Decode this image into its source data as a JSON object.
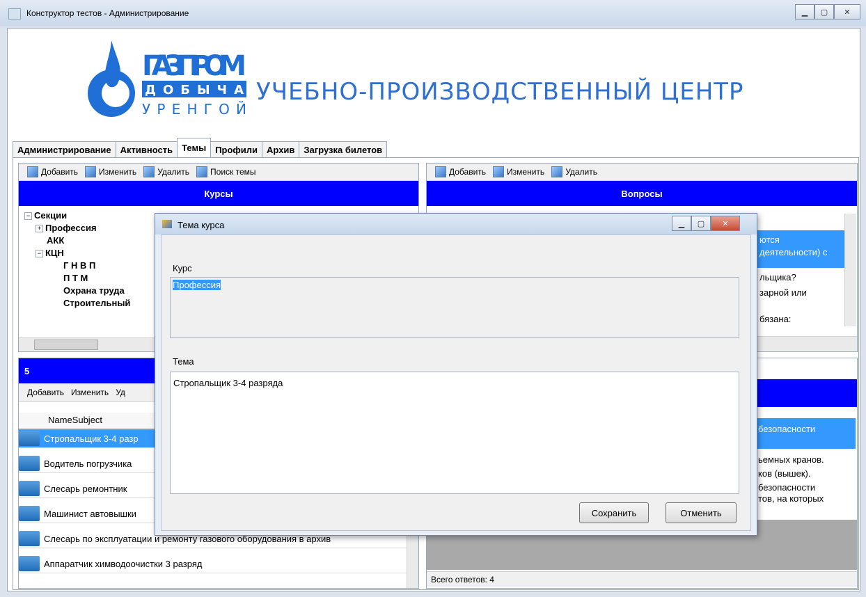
{
  "window": {
    "title": "Конструктор тестов - Администрирование",
    "caption_buttons": [
      "minimize",
      "maximize",
      "close"
    ]
  },
  "header": {
    "logo": {
      "line1": "ГАЗПРОМ",
      "line2": "ДОБЫЧА",
      "line3": "УРЕНГОЙ"
    },
    "title": "УЧЕБНО-ПРОИЗВОДСТВЕННЫЙ ЦЕНТР"
  },
  "tabs": [
    {
      "label": "Администрирование",
      "selected": false
    },
    {
      "label": "Активность",
      "selected": false
    },
    {
      "label": "Темы",
      "selected": true
    },
    {
      "label": "Профили",
      "selected": false
    },
    {
      "label": "Архив",
      "selected": false
    },
    {
      "label": "Загрузка билетов",
      "selected": false
    }
  ],
  "left_toolbar": {
    "add": "Добавить",
    "edit": "Изменить",
    "delete": "Удалить",
    "search": "Поиск темы"
  },
  "courses": {
    "header": "Курсы",
    "tree": [
      {
        "label": "Секции",
        "expander": "-"
      },
      {
        "label": "Профессия",
        "expander": "+"
      },
      {
        "label": "АКК",
        "expander": ""
      },
      {
        "label": "КЦН",
        "expander": "-"
      },
      {
        "label": "Г Н В П",
        "expander": ""
      },
      {
        "label": "П Т М",
        "expander": ""
      },
      {
        "label": "Охрана труда",
        "expander": ""
      },
      {
        "label": "Строительный",
        "expander": ""
      }
    ]
  },
  "subjects": {
    "count_header": "5",
    "toolbar": {
      "add": "Добавить",
      "edit": "Изменить",
      "delete": "Уд"
    },
    "column": "NameSubject",
    "rows": [
      "Стропальщик 3-4 разр",
      "Водитель погрузчика",
      "Слесарь ремонтник",
      "Машинист автовышки",
      "Слесарь по эксплуатации и ремонту газового оборудования в архив",
      "Аппаратчик химводоочистки 3 разряд"
    ]
  },
  "right_toolbar": {
    "add": "Добавить",
    "edit": "Изменить",
    "delete": "Удалить"
  },
  "questions": {
    "header": "Вопросы",
    "visible_fragments": [
      "ются",
      "деятельности) с",
      "льщика?",
      "зарной или",
      "бязана:"
    ]
  },
  "answers": {
    "visible_fragments": [
      "безопасности",
      "ьемных кранов.",
      "ков (вышек).",
      "безопасности",
      "тов, на которых"
    ],
    "status": "Всего ответов: 4"
  },
  "dialog": {
    "title": "Тема курса",
    "course_label": "Курс",
    "course_value": "Профессия",
    "topic_label": "Тема",
    "topic_value": "Стропальщик 3-4 разряда",
    "save": "Сохранить",
    "cancel": "Отменить"
  },
  "colors": {
    "accent_blue": "#0000ff",
    "header_text": "#2f6fd1",
    "selection": "#3399ff"
  }
}
